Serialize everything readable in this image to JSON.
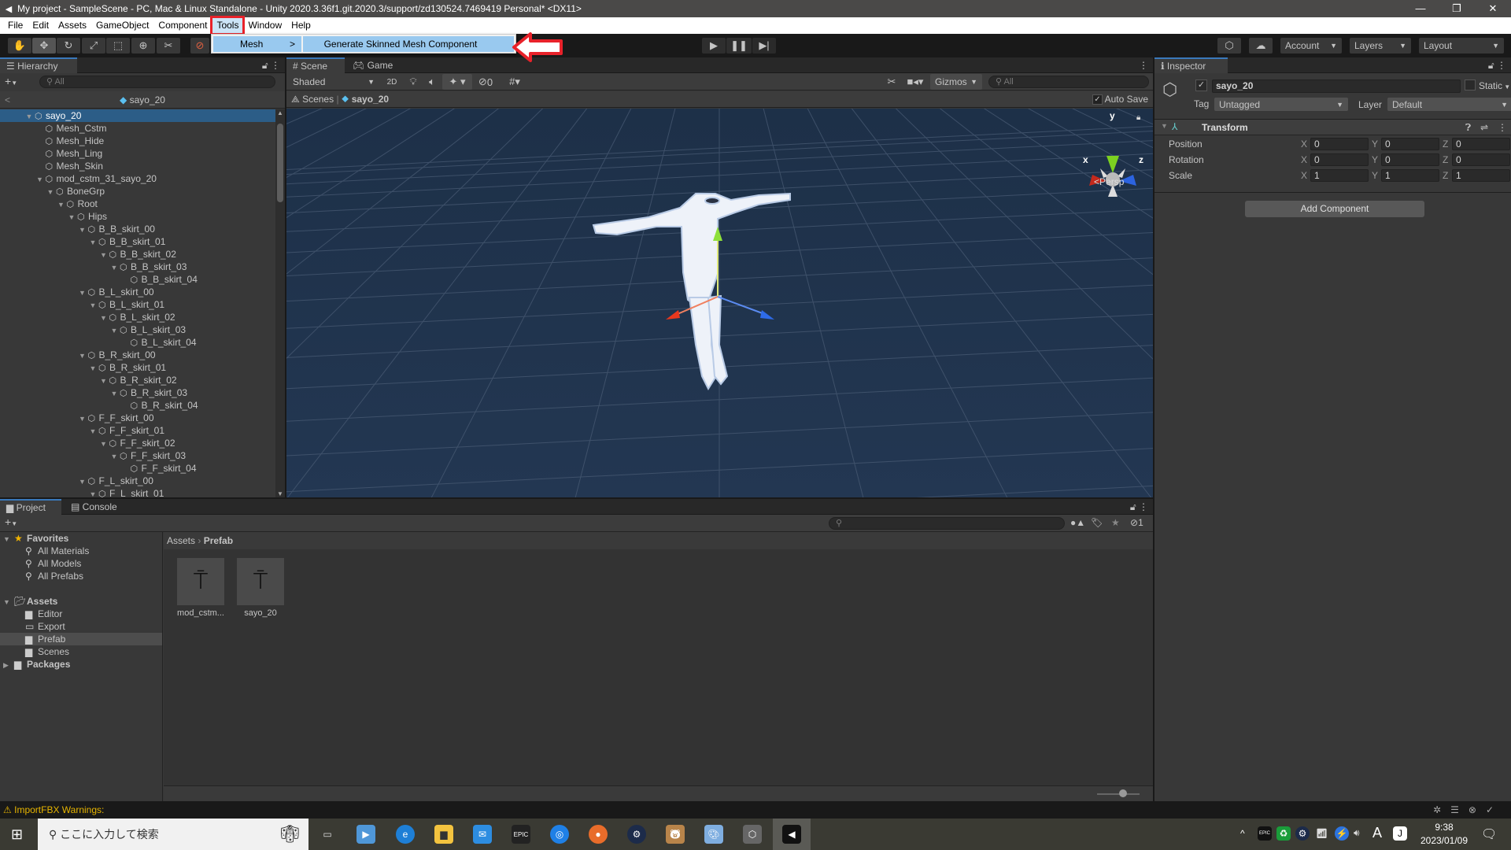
{
  "window": {
    "title": "My project - SampleScene - PC, Mac & Linux Standalone - Unity 2020.3.36f1.git.2020.3/support/zd130524.7469419 Personal* <DX11>",
    "minimize": "—",
    "restore": "❐",
    "close": "✕"
  },
  "menubar": {
    "items": [
      "File",
      "Edit",
      "Assets",
      "GameObject",
      "Component",
      "Tools",
      "Window",
      "Help"
    ],
    "active": "Tools"
  },
  "tools_menu": {
    "item": "Mesh",
    "arrow": ">",
    "submenu_item": "Generate Skinned Mesh Component"
  },
  "toolbar": {
    "tools": [
      "hand-tool",
      "move-tool",
      "rotate-tool",
      "scale-tool",
      "rect-tool",
      "transform-tool",
      "custom-tool"
    ],
    "active_tool": "move-tool",
    "account": "Account",
    "layers": "Layers",
    "layout": "Layout"
  },
  "hierarchy": {
    "tab": "Hierarchy",
    "search_placeholder": "All",
    "breadcrumb": "sayo_20",
    "items": [
      {
        "label": "sayo_20",
        "depth": 0,
        "expanded": true,
        "selected": true
      },
      {
        "label": "Mesh_Cstm",
        "depth": 1,
        "expanded": null
      },
      {
        "label": "Mesh_Hide",
        "depth": 1,
        "expanded": null
      },
      {
        "label": "Mesh_Ling",
        "depth": 1,
        "expanded": null
      },
      {
        "label": "Mesh_Skin",
        "depth": 1,
        "expanded": null
      },
      {
        "label": "mod_cstm_31_sayo_20",
        "depth": 1,
        "expanded": true
      },
      {
        "label": "BoneGrp",
        "depth": 2,
        "expanded": true
      },
      {
        "label": "Root",
        "depth": 3,
        "expanded": true
      },
      {
        "label": "Hips",
        "depth": 4,
        "expanded": true
      },
      {
        "label": "B_B_skirt_00",
        "depth": 5,
        "expanded": true
      },
      {
        "label": "B_B_skirt_01",
        "depth": 6,
        "expanded": true
      },
      {
        "label": "B_B_skirt_02",
        "depth": 7,
        "expanded": true
      },
      {
        "label": "B_B_skirt_03",
        "depth": 8,
        "expanded": true
      },
      {
        "label": "B_B_skirt_04",
        "depth": 9,
        "expanded": null
      },
      {
        "label": "B_L_skirt_00",
        "depth": 5,
        "expanded": true
      },
      {
        "label": "B_L_skirt_01",
        "depth": 6,
        "expanded": true
      },
      {
        "label": "B_L_skirt_02",
        "depth": 7,
        "expanded": true
      },
      {
        "label": "B_L_skirt_03",
        "depth": 8,
        "expanded": true
      },
      {
        "label": "B_L_skirt_04",
        "depth": 9,
        "expanded": null
      },
      {
        "label": "B_R_skirt_00",
        "depth": 5,
        "expanded": true
      },
      {
        "label": "B_R_skirt_01",
        "depth": 6,
        "expanded": true
      },
      {
        "label": "B_R_skirt_02",
        "depth": 7,
        "expanded": true
      },
      {
        "label": "B_R_skirt_03",
        "depth": 8,
        "expanded": true
      },
      {
        "label": "B_R_skirt_04",
        "depth": 9,
        "expanded": null
      },
      {
        "label": "F_F_skirt_00",
        "depth": 5,
        "expanded": true
      },
      {
        "label": "F_F_skirt_01",
        "depth": 6,
        "expanded": true
      },
      {
        "label": "F_F_skirt_02",
        "depth": 7,
        "expanded": true
      },
      {
        "label": "F_F_skirt_03",
        "depth": 8,
        "expanded": true
      },
      {
        "label": "F_F_skirt_04",
        "depth": 9,
        "expanded": null
      },
      {
        "label": "F_L_skirt_00",
        "depth": 5,
        "expanded": true
      },
      {
        "label": "F_L_skirt_01",
        "depth": 6,
        "expanded": true
      }
    ]
  },
  "scene": {
    "tabs": [
      "Scene",
      "Game"
    ],
    "shading_mode": "Shaded",
    "mode_2d": "2D",
    "hidden_count": "0",
    "gizmos": "Gizmos",
    "search_placeholder": "All",
    "breadcrumb_root": "Scenes",
    "breadcrumb_item": "sayo_20",
    "auto_save_label": "Auto Save",
    "auto_save_checked": true,
    "axis_x": "x",
    "axis_y": "y",
    "axis_z": "z",
    "projection": "Persp"
  },
  "inspector": {
    "tab": "Inspector",
    "object_name": "sayo_20",
    "active_checked": true,
    "static_label": "Static",
    "tag_label": "Tag",
    "tag_value": "Untagged",
    "layer_label": "Layer",
    "layer_value": "Default",
    "component_title": "Transform",
    "rows": [
      {
        "label": "Position",
        "x": "0",
        "y": "0",
        "z": "0"
      },
      {
        "label": "Rotation",
        "x": "0",
        "y": "0",
        "z": "0"
      },
      {
        "label": "Scale",
        "x": "1",
        "y": "1",
        "z": "1"
      }
    ],
    "axis_labels": [
      "X",
      "Y",
      "Z"
    ],
    "add_component": "Add Component"
  },
  "project": {
    "tabs": [
      "Project",
      "Console"
    ],
    "hidden_count": "1",
    "tree": [
      {
        "label": "Favorites",
        "depth": 0,
        "icon": "star",
        "bold": true,
        "expanded": true
      },
      {
        "label": "All Materials",
        "depth": 1,
        "icon": "search"
      },
      {
        "label": "All Models",
        "depth": 1,
        "icon": "search"
      },
      {
        "label": "All Prefabs",
        "depth": 1,
        "icon": "search"
      },
      {
        "label": "",
        "depth": 0,
        "icon": "none"
      },
      {
        "label": "Assets",
        "depth": 0,
        "icon": "folder-open",
        "bold": true,
        "expanded": true
      },
      {
        "label": "Editor",
        "depth": 1,
        "icon": "folder"
      },
      {
        "label": "Export",
        "depth": 1,
        "icon": "folder-empty"
      },
      {
        "label": "Prefab",
        "depth": 1,
        "icon": "folder",
        "selected": true
      },
      {
        "label": "Scenes",
        "depth": 1,
        "icon": "folder"
      },
      {
        "label": "Packages",
        "depth": 0,
        "icon": "folder",
        "bold": true,
        "expanded": false
      }
    ],
    "breadcrumb": [
      "Assets",
      "Prefab"
    ],
    "assets": [
      {
        "label": "mod_cstm..."
      },
      {
        "label": "sayo_20"
      }
    ]
  },
  "status": {
    "message": "ImportFBX Warnings:"
  },
  "taskbar": {
    "search_placeholder": "ここに入力して検索",
    "time": "9:38",
    "date": "2023/01/09",
    "ime": "A"
  }
}
